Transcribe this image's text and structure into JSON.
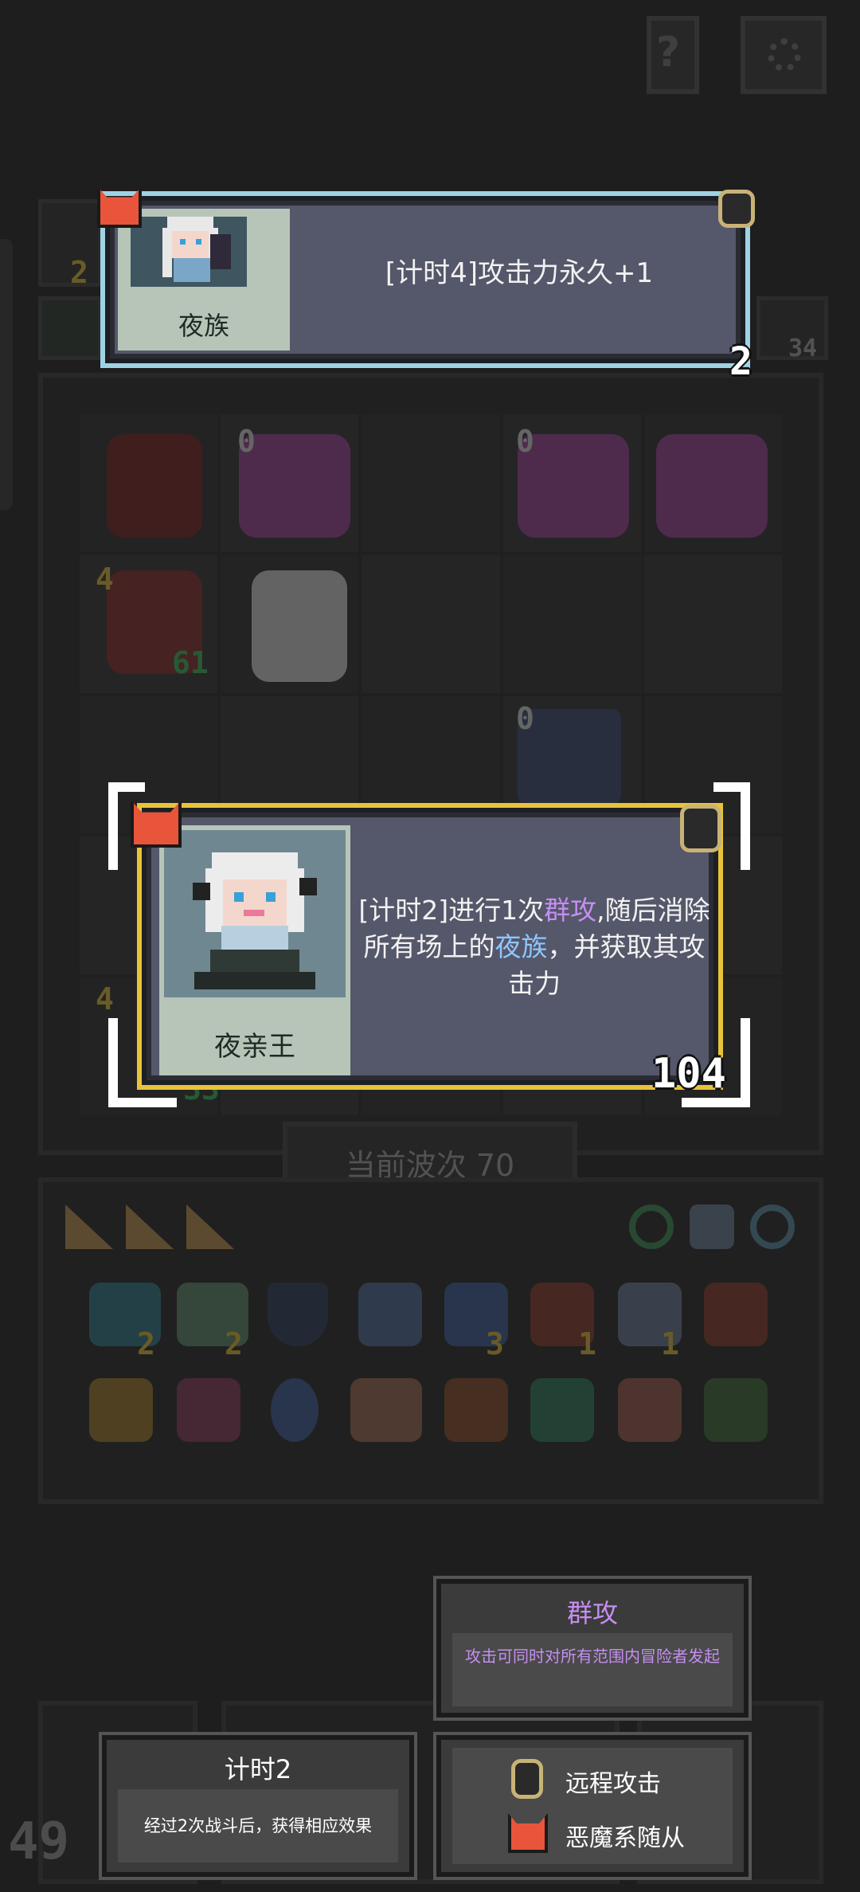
{
  "top_card": {
    "name": "夜族",
    "description": "[计时4]攻击力永久+1",
    "count": "2"
  },
  "main_card": {
    "name": "夜亲王",
    "description_prefix": "[计时2]进行1次",
    "keyword_group_attack": "群攻",
    "description_middle": ",随后消除所有场上的",
    "keyword_night_clan": "夜族",
    "description_suffix": "，并获取其攻击力",
    "attack": "104"
  },
  "background": {
    "wave_label": "当前波次 70",
    "gold_count": "49",
    "side_count": "34",
    "side_badge_left": "2",
    "board_badges": [
      "0",
      "0",
      "0",
      "4",
      "61",
      "0",
      "4",
      "33"
    ],
    "item_counts": [
      "2",
      "2",
      "3",
      "1",
      "1"
    ]
  },
  "tooltips": {
    "group_attack": {
      "title": "群攻",
      "body": "攻击可同时对所有范围内冒险者发起"
    },
    "timer": {
      "title": "计时2",
      "body": "经过2次战斗后，获得相应效果"
    },
    "tags": [
      {
        "icon": "ranged-attack-icon",
        "label": "远程攻击"
      },
      {
        "icon": "demon-minion-icon",
        "label": "恶魔系随从"
      }
    ]
  },
  "colors": {
    "keyword_purple": "#c58ef0",
    "keyword_blue": "#8fc6ff",
    "card_border_blue": "#9fd3e4",
    "card_border_gold": "#e8c33a"
  }
}
